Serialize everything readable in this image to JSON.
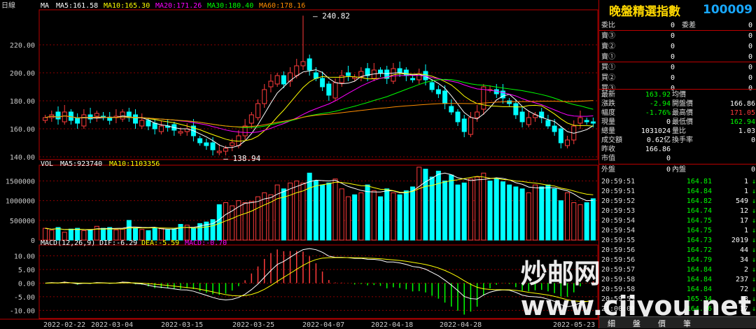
{
  "colors": {
    "up": "#ff3b3b",
    "down": "#00ffff",
    "grid": "#8b0000",
    "ma5": "#ffffff",
    "ma10": "#ffff00",
    "ma20": "#ff00ff",
    "ma30": "#00ff00",
    "ma60": "#ff8c00"
  },
  "price_panel": {
    "period": "日線",
    "ma_label": "MA",
    "ma5": "MA5:161.58",
    "ma10": "MA10:165.30",
    "ma20": "MA20:171.26",
    "ma30": "MA30:180.40",
    "ma60": "MA60:178.16",
    "high_mark": "240.82",
    "low_mark": "138.94"
  },
  "volume_panel": {
    "title": "VOL",
    "ma5": "MA5:923740",
    "ma10": "MA10:1103356"
  },
  "macd_panel": {
    "title": "MACD(12,26,9)",
    "dif": "DIF:-6.29",
    "dea": "DEA:-5.59",
    "macd": "MACD:-0.70"
  },
  "chart_data": [
    {
      "type": "candlestick",
      "title": "日線",
      "y_ticks": [
        "220.00",
        "200.00",
        "180.00",
        "160.00",
        "140.00"
      ],
      "ylim": [
        138,
        245
      ],
      "x_tick_labels": [
        "2022-02-22",
        "2022-03-04",
        "2022-03-15",
        "2022-03-25",
        "2022-04-07",
        "2022-04-18",
        "2022-04-28",
        "2022-05-23"
      ],
      "annotations": [
        {
          "text": "240.82",
          "value": 240.82
        },
        {
          "text": "138.94",
          "value": 138.94
        }
      ],
      "closes": [
        168,
        170,
        167,
        172,
        166,
        164,
        170,
        167,
        171,
        168,
        166,
        169,
        172,
        168,
        164,
        166,
        162,
        160,
        162,
        161,
        159,
        158,
        160,
        155,
        150,
        148,
        145,
        144,
        146,
        150,
        155,
        162,
        170,
        178,
        188,
        194,
        198,
        192,
        200,
        205,
        208,
        202,
        196,
        190,
        184,
        193,
        198,
        198,
        197,
        201,
        198,
        202,
        200,
        196,
        203,
        200,
        198,
        195,
        199,
        195,
        188,
        185,
        178,
        172,
        165,
        158,
        168,
        172,
        190,
        188,
        185,
        182,
        178,
        170,
        165,
        168,
        170,
        168,
        162,
        158,
        150,
        152,
        162,
        168,
        165,
        164
      ]
    },
    {
      "type": "bar",
      "title": "VOL",
      "y_ticks": [
        "1500000",
        "1000000",
        "500000",
        "0"
      ],
      "ylim": [
        0,
        1900000
      ],
      "values": [
        300000,
        250000,
        320000,
        200000,
        280000,
        300000,
        240000,
        260000,
        350000,
        300000,
        320000,
        260000,
        280000,
        500000,
        300000,
        270000,
        240000,
        320000,
        300000,
        260000,
        280000,
        400000,
        380000,
        300000,
        420000,
        460000,
        520000,
        900000,
        950000,
        870000,
        1000000,
        950000,
        980000,
        1100000,
        1200000,
        1150000,
        1400000,
        1300000,
        1450000,
        1500000,
        1450000,
        1700000,
        1500000,
        1400000,
        1450000,
        1550000,
        1300000,
        1100000,
        1150000,
        1200000,
        1400000,
        1250000,
        1100000,
        1300000,
        1200000,
        1150000,
        1250000,
        1350000,
        1850000,
        1800000,
        1600000,
        1750000,
        1500000,
        1650000,
        1400000,
        1450000,
        1550000,
        1600000,
        1700000,
        1500000,
        1550000,
        1480000,
        1400000,
        1350000,
        1300000,
        1200000,
        1400000,
        1350000,
        1400000,
        1300000,
        1000000,
        1200000,
        950000,
        900000,
        950000,
        1050000
      ],
      "ma5": 923740,
      "ma10": 1103356
    },
    {
      "type": "line",
      "title": "MACD(12,26,9)",
      "y_ticks": [
        "10.00",
        "5.00",
        "0.00",
        "-5.00",
        "-10.00"
      ],
      "ylim": [
        -13,
        14
      ],
      "series": [
        {
          "name": "DIF",
          "last": -6.29
        },
        {
          "name": "DEA",
          "last": -5.59
        },
        {
          "name": "MACD",
          "last": -0.7
        }
      ]
    }
  ],
  "quote": {
    "title": "晚盤精選指數",
    "code": "100009",
    "order_rows": [
      {
        "label": "委比",
        "value": "0",
        "label2": "委差",
        "value2": "0"
      },
      {
        "label": "賣③",
        "value": "0",
        "value2": "0"
      },
      {
        "label": "賣②",
        "value": "0",
        "value2": "0"
      },
      {
        "label": "賣①",
        "value": "0",
        "value2": "0"
      },
      {
        "label": "買①",
        "value": "0",
        "value2": "0"
      },
      {
        "label": "買②",
        "value": "0",
        "value2": "0"
      },
      {
        "label": "買③",
        "value": "0",
        "value2": "0"
      }
    ],
    "stats": [
      {
        "l1": "最新",
        "v1": "163.92",
        "c1": "#00ff00",
        "l2": "均價",
        "v2": "",
        "c2": "#fff"
      },
      {
        "l1": "漲跌",
        "v1": "-2.94",
        "c1": "#00ff00",
        "l2": "開盤價",
        "v2": "166.86",
        "c2": "#fff"
      },
      {
        "l1": "幅度",
        "v1": "-1.76%",
        "c1": "#00ff00",
        "l2": "最高價",
        "v2": "171.05",
        "c2": "#ff3b3b"
      },
      {
        "l1": "現量",
        "v1": "0",
        "c1": "#fff",
        "l2": "最低價",
        "v2": "162.94",
        "c2": "#00ff00"
      },
      {
        "l1": "總量",
        "v1": "1031024",
        "c1": "#fff",
        "l2": "量比",
        "v2": "1.03",
        "c2": "#fff"
      },
      {
        "l1": "成交額",
        "v1": "0.62亿",
        "c1": "#fff",
        "l2": "換手率",
        "v2": "0",
        "c2": "#fff"
      },
      {
        "l1": "昨收",
        "v1": "166.86",
        "c1": "#fff",
        "l2": "",
        "v2": "",
        "c2": "#fff"
      },
      {
        "l1": "市值",
        "v1": "0",
        "c1": "#fff",
        "l2": "",
        "v2": "",
        "c2": "#fff"
      },
      {
        "l1": "外盤",
        "v1": "0",
        "c1": "#fff",
        "l2": "內盤",
        "v2": "0",
        "c2": "#fff"
      }
    ],
    "ticks": [
      {
        "time": "20:59:51",
        "price": "164.81",
        "vol": "1",
        "dir": "↓"
      },
      {
        "time": "20:59:51",
        "price": "164.84",
        "vol": "1",
        "dir": "↓"
      },
      {
        "time": "20:59:52",
        "price": "164.82",
        "vol": "549",
        "dir": "↓"
      },
      {
        "time": "20:59:53",
        "price": "164.74",
        "vol": "12",
        "dir": "↓"
      },
      {
        "time": "20:59:54",
        "price": "164.75",
        "vol": "17",
        "dir": "↓"
      },
      {
        "time": "20:59:54",
        "price": "164.75",
        "vol": "1",
        "dir": "↓"
      },
      {
        "time": "20:59:55",
        "price": "164.73",
        "vol": "2019",
        "dir": "↓"
      },
      {
        "time": "20:59:56",
        "price": "164.72",
        "vol": "44",
        "dir": "↓"
      },
      {
        "time": "20:59:56",
        "price": "164.79",
        "vol": "34",
        "dir": "↓"
      },
      {
        "time": "20:59:57",
        "price": "164.84",
        "vol": "2",
        "dir": "↓"
      },
      {
        "time": "20:59:58",
        "price": "164.84",
        "vol": "237",
        "dir": "↓"
      },
      {
        "time": "20:59:58",
        "price": "164.84",
        "vol": "72",
        "dir": "↓"
      },
      {
        "time": "20:59:59",
        "price": "165.34",
        "vol": "3",
        "dir": "↓"
      },
      {
        "time": "21:00:00",
        "price": "164.86",
        "vol": "17",
        "dir": "↓"
      }
    ],
    "tabs": [
      "細",
      "盤",
      "價",
      "筆"
    ]
  },
  "watermark": "炒邮网 www.cjiyou.net"
}
